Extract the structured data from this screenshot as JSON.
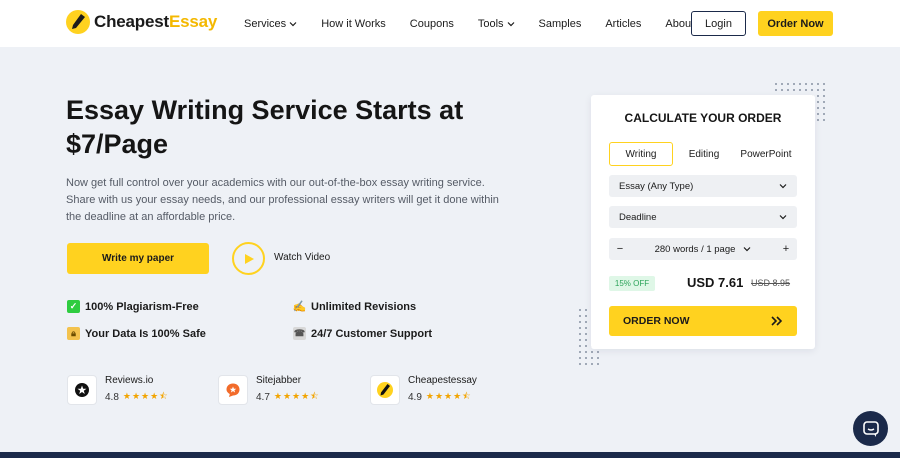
{
  "brand": {
    "part1": "Cheapest",
    "part2": "Essay"
  },
  "nav": {
    "items": [
      {
        "label": "Services",
        "dropdown": true
      },
      {
        "label": "How it Works",
        "dropdown": false
      },
      {
        "label": "Coupons",
        "dropdown": false
      },
      {
        "label": "Tools",
        "dropdown": true
      },
      {
        "label": "Samples",
        "dropdown": false
      },
      {
        "label": "Articles",
        "dropdown": false
      },
      {
        "label": "About",
        "dropdown": true
      }
    ],
    "login": "Login",
    "order_now": "Order Now"
  },
  "hero": {
    "title": "Essay Writing Service Starts at $7/Page",
    "description": "Now get full control over your academics with our out-of-the-box essay writing service. Share with us your essay needs, and our professional essay writers will get it done within the deadline at an affordable price.",
    "write_button": "Write my paper",
    "watch_video": "Watch Video"
  },
  "features": [
    "100% Plagiarism-Free",
    "Unlimited Revisions",
    "Your Data Is 100% Safe",
    "24/7 Customer Support"
  ],
  "reviews": [
    {
      "name": "Reviews.io",
      "score": "4.8",
      "stars": "★★★★⯪"
    },
    {
      "name": "Sitejabber",
      "score": "4.7",
      "stars": "★★★★⯪"
    },
    {
      "name": "Cheapestessay",
      "score": "4.9",
      "stars": "★★★★⯪"
    }
  ],
  "calculator": {
    "title": "CALCULATE YOUR ORDER",
    "tabs": [
      "Writing",
      "Editing",
      "PowerPoint"
    ],
    "active_tab": "Writing",
    "paper_type": "Essay (Any Type)",
    "deadline": "Deadline",
    "minus": "−",
    "plus": "+",
    "pages": "280 words / 1 page",
    "discount": "15% OFF",
    "price": "USD 7.61",
    "old_price": "USD 8.95",
    "order_button": "ORDER NOW"
  },
  "colors": {
    "accent": "#ffd21f",
    "navy": "#1b2a4a",
    "background": "#eef1f6"
  }
}
